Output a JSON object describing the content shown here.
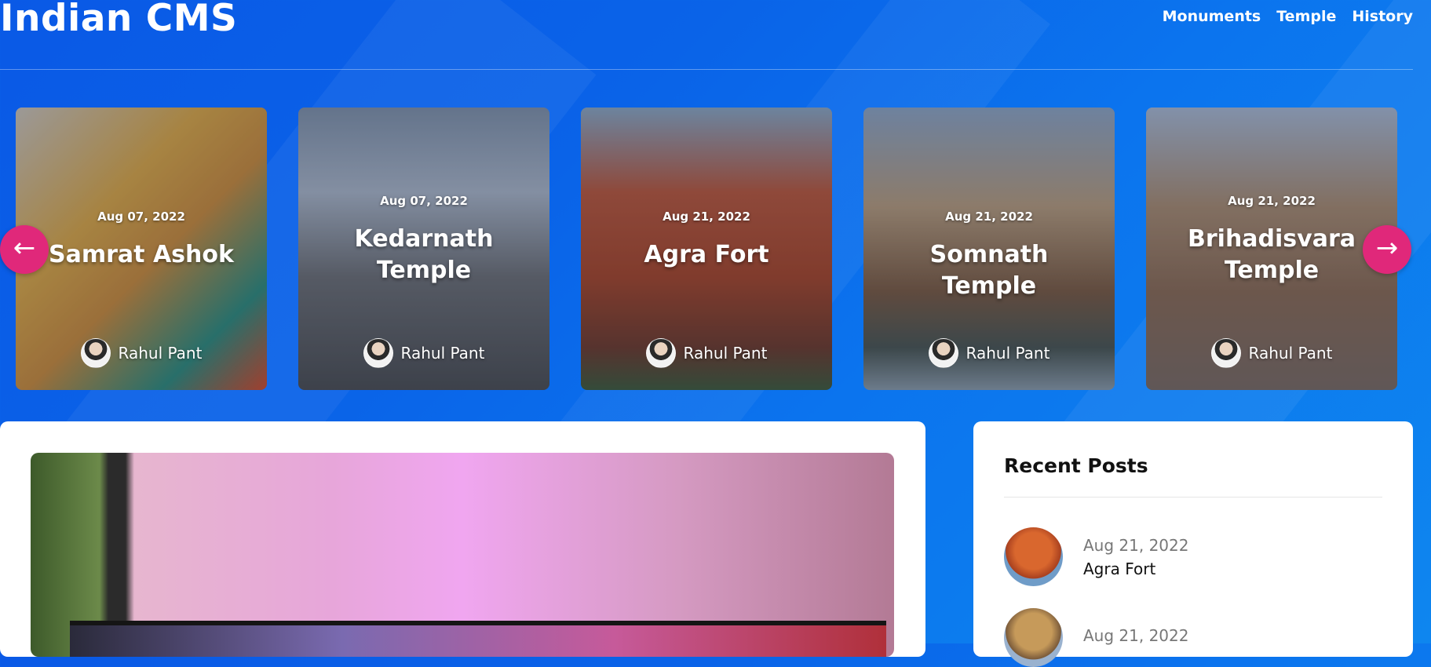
{
  "site": {
    "brand": "Indian CMS"
  },
  "nav": [
    "Monuments",
    "Temple",
    "History"
  ],
  "carousel": {
    "cards": [
      {
        "date": "Aug 07, 2022",
        "title": "Samrat Ashok",
        "author": "Rahul Pant"
      },
      {
        "date": "Aug 07, 2022",
        "title": "Kedarnath Temple",
        "author": "Rahul Pant"
      },
      {
        "date": "Aug 21, 2022",
        "title": "Agra Fort",
        "author": "Rahul Pant"
      },
      {
        "date": "Aug 21, 2022",
        "title": "Somnath Temple",
        "author": "Rahul Pant"
      },
      {
        "date": "Aug 21, 2022",
        "title": "Brihadisvara Temple",
        "author": "Rahul Pant"
      }
    ],
    "prev_icon": "←",
    "next_icon": "→"
  },
  "recent": {
    "title": "Recent Posts",
    "posts": [
      {
        "date": "Aug 21, 2022",
        "title": "Agra Fort"
      },
      {
        "date": "Aug 21, 2022",
        "title": ""
      }
    ]
  },
  "colors": {
    "accent": "#e0287a",
    "background": "#0a63e8"
  }
}
